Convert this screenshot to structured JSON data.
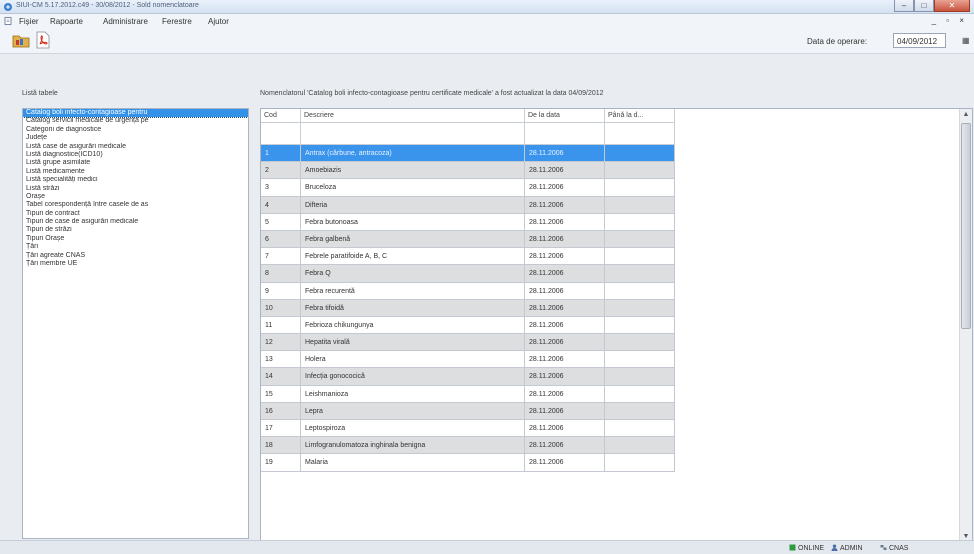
{
  "window": {
    "title": "SIUI-CM 5.17.2012.c49 - 30/08/2012 - Sold nomenclatoare",
    "controls": {
      "minimize": "–",
      "maximize": "□",
      "close": "✕"
    }
  },
  "menu": [
    "Fișier",
    "Rapoarte",
    "Administrare",
    "Ferestre",
    "Ajutor"
  ],
  "mdi_controls": "_ ▫ ×",
  "toolbar": {
    "buttons": [
      "folder-icon",
      "pdf-icon"
    ],
    "date_label": "Data de operare:",
    "date_value": "04/09/2012",
    "calendar_icon": "▦"
  },
  "left_panel": {
    "title": "Listă tabele",
    "items": [
      "Catalog boli infecto-contagioase pentru",
      "Catalog servicii medicale de urgență pe",
      "Categorii de diagnostice",
      "Județe",
      "Listă case de asigurări medicale",
      "Listă diagnostice(ICD10)",
      "Listă grupe asimilate",
      "Listă medicamente",
      "Listă specialități medici",
      "Listă străzi",
      "Orașe",
      "Tabel corespondență între casele de as",
      "Tipuri de contract",
      "Tipuri de case de asigurări medicale",
      "Tipuri de străzi",
      "Tipuri Orașe",
      "Țări",
      "Țări agreate CNAS",
      "Țări membre UE"
    ],
    "selected_index": 0
  },
  "main": {
    "status_message": "Nomenclatorul 'Catalog boli infecto-contagioase pentru certificate medicale' a fost actualizat la data 04/09/2012",
    "columns": [
      "Cod",
      "Descriere",
      "De la data",
      "Până la d..."
    ],
    "rows": [
      {
        "cod": "1",
        "descriere": "Antrax (cărbune, antracoza)",
        "de_la": "28.11.2006",
        "pana_la": ""
      },
      {
        "cod": "2",
        "descriere": "Amoebiazis",
        "de_la": "28.11.2006",
        "pana_la": ""
      },
      {
        "cod": "3",
        "descriere": "Bruceloza",
        "de_la": "28.11.2006",
        "pana_la": ""
      },
      {
        "cod": "4",
        "descriere": "Difteria",
        "de_la": "28.11.2006",
        "pana_la": ""
      },
      {
        "cod": "5",
        "descriere": "Febra butonoasa",
        "de_la": "28.11.2006",
        "pana_la": ""
      },
      {
        "cod": "6",
        "descriere": "Febra galbenă",
        "de_la": "28.11.2006",
        "pana_la": ""
      },
      {
        "cod": "7",
        "descriere": "Febrele paratifoide A, B, C",
        "de_la": "28.11.2006",
        "pana_la": ""
      },
      {
        "cod": "8",
        "descriere": "Febra Q",
        "de_la": "28.11.2006",
        "pana_la": ""
      },
      {
        "cod": "9",
        "descriere": "Febra recurentă",
        "de_la": "28.11.2006",
        "pana_la": ""
      },
      {
        "cod": "10",
        "descriere": "Febra tifoidă",
        "de_la": "28.11.2006",
        "pana_la": ""
      },
      {
        "cod": "11",
        "descriere": "Febrioza chikungunya",
        "de_la": "28.11.2006",
        "pana_la": ""
      },
      {
        "cod": "12",
        "descriere": "Hepatita virală",
        "de_la": "28.11.2006",
        "pana_la": ""
      },
      {
        "cod": "13",
        "descriere": "Holera",
        "de_la": "28.11.2006",
        "pana_la": ""
      },
      {
        "cod": "14",
        "descriere": "Infecția gonococică",
        "de_la": "28.11.2006",
        "pana_la": ""
      },
      {
        "cod": "15",
        "descriere": "Leishmanioza",
        "de_la": "28.11.2006",
        "pana_la": ""
      },
      {
        "cod": "16",
        "descriere": "Lepra",
        "de_la": "28.11.2006",
        "pana_la": ""
      },
      {
        "cod": "17",
        "descriere": "Leptospiroza",
        "de_la": "28.11.2006",
        "pana_la": ""
      },
      {
        "cod": "18",
        "descriere": "Limfogranulomatoza inghinala benigna",
        "de_la": "28.11.2006",
        "pana_la": ""
      },
      {
        "cod": "19",
        "descriere": "Malaria",
        "de_la": "28.11.2006",
        "pana_la": ""
      }
    ],
    "selected_row": 0,
    "scroll_up": "▲",
    "scroll_down": "▼"
  },
  "statusbar": {
    "online": "ONLINE",
    "user": "ADMIN",
    "server": "CNAS"
  },
  "colors": {
    "selection": "#3b94ec",
    "alt_row": "#dddedf"
  }
}
